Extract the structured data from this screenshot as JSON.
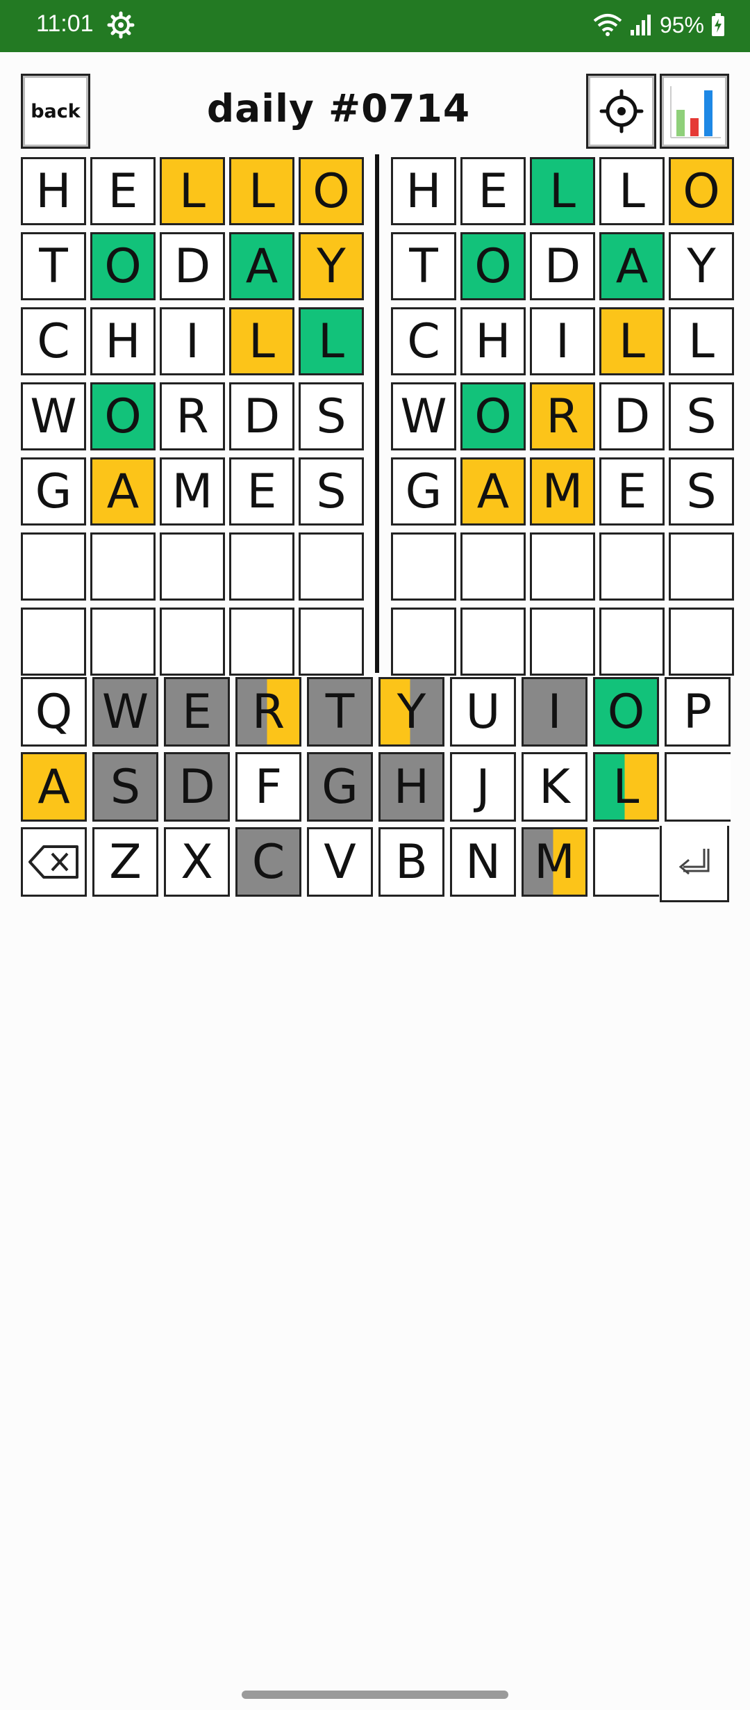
{
  "status_bar": {
    "time": "11:01",
    "battery_percent": "95%",
    "icons": [
      "settings-gear-icon",
      "wifi-icon",
      "signal-icon",
      "battery-charging-icon"
    ],
    "background": "#237a23"
  },
  "header": {
    "back_label": "back",
    "title": "daily #0714"
  },
  "colors": {
    "correct": "#12c27a",
    "present": "#fcc419",
    "absent": "#888888"
  },
  "boards": [
    {
      "rows": [
        [
          {
            "l": "H",
            "s": ""
          },
          {
            "l": "E",
            "s": ""
          },
          {
            "l": "L",
            "s": "y"
          },
          {
            "l": "L",
            "s": "y"
          },
          {
            "l": "O",
            "s": "y"
          }
        ],
        [
          {
            "l": "T",
            "s": ""
          },
          {
            "l": "O",
            "s": "g"
          },
          {
            "l": "D",
            "s": ""
          },
          {
            "l": "A",
            "s": "g"
          },
          {
            "l": "Y",
            "s": "y"
          }
        ],
        [
          {
            "l": "C",
            "s": ""
          },
          {
            "l": "H",
            "s": ""
          },
          {
            "l": "I",
            "s": ""
          },
          {
            "l": "L",
            "s": "y"
          },
          {
            "l": "L",
            "s": "g"
          }
        ],
        [
          {
            "l": "W",
            "s": ""
          },
          {
            "l": "O",
            "s": "g"
          },
          {
            "l": "R",
            "s": ""
          },
          {
            "l": "D",
            "s": ""
          },
          {
            "l": "S",
            "s": ""
          }
        ],
        [
          {
            "l": "G",
            "s": ""
          },
          {
            "l": "A",
            "s": "y"
          },
          {
            "l": "M",
            "s": ""
          },
          {
            "l": "E",
            "s": ""
          },
          {
            "l": "S",
            "s": ""
          }
        ],
        [
          {
            "l": "",
            "s": ""
          },
          {
            "l": "",
            "s": ""
          },
          {
            "l": "",
            "s": ""
          },
          {
            "l": "",
            "s": ""
          },
          {
            "l": "",
            "s": ""
          }
        ],
        [
          {
            "l": "",
            "s": ""
          },
          {
            "l": "",
            "s": ""
          },
          {
            "l": "",
            "s": ""
          },
          {
            "l": "",
            "s": ""
          },
          {
            "l": "",
            "s": ""
          }
        ]
      ]
    },
    {
      "rows": [
        [
          {
            "l": "H",
            "s": ""
          },
          {
            "l": "E",
            "s": ""
          },
          {
            "l": "L",
            "s": "g"
          },
          {
            "l": "L",
            "s": ""
          },
          {
            "l": "O",
            "s": "y"
          }
        ],
        [
          {
            "l": "T",
            "s": ""
          },
          {
            "l": "O",
            "s": "g"
          },
          {
            "l": "D",
            "s": ""
          },
          {
            "l": "A",
            "s": "g"
          },
          {
            "l": "Y",
            "s": ""
          }
        ],
        [
          {
            "l": "C",
            "s": ""
          },
          {
            "l": "H",
            "s": ""
          },
          {
            "l": "I",
            "s": ""
          },
          {
            "l": "L",
            "s": "y"
          },
          {
            "l": "L",
            "s": ""
          }
        ],
        [
          {
            "l": "W",
            "s": ""
          },
          {
            "l": "O",
            "s": "g"
          },
          {
            "l": "R",
            "s": "y"
          },
          {
            "l": "D",
            "s": ""
          },
          {
            "l": "S",
            "s": ""
          }
        ],
        [
          {
            "l": "G",
            "s": ""
          },
          {
            "l": "A",
            "s": "y"
          },
          {
            "l": "M",
            "s": "y"
          },
          {
            "l": "E",
            "s": ""
          },
          {
            "l": "S",
            "s": ""
          }
        ],
        [
          {
            "l": "",
            "s": ""
          },
          {
            "l": "",
            "s": ""
          },
          {
            "l": "",
            "s": ""
          },
          {
            "l": "",
            "s": ""
          },
          {
            "l": "",
            "s": ""
          }
        ],
        [
          {
            "l": "",
            "s": ""
          },
          {
            "l": "",
            "s": ""
          },
          {
            "l": "",
            "s": ""
          },
          {
            "l": "",
            "s": ""
          },
          {
            "l": "",
            "s": ""
          }
        ]
      ]
    }
  ],
  "keyboard": {
    "rows": [
      [
        {
          "k": "Q",
          "c": ""
        },
        {
          "k": "W",
          "c": "gray"
        },
        {
          "k": "E",
          "c": "gray"
        },
        {
          "k": "R",
          "c": "split-gy"
        },
        {
          "k": "T",
          "c": "gray"
        },
        {
          "k": "Y",
          "c": "split-yg"
        },
        {
          "k": "U",
          "c": ""
        },
        {
          "k": "I",
          "c": "gray"
        },
        {
          "k": "O",
          "c": "grn"
        },
        {
          "k": "P",
          "c": ""
        }
      ],
      [
        {
          "k": "A",
          "c": "yel"
        },
        {
          "k": "S",
          "c": "gray"
        },
        {
          "k": "D",
          "c": "gray"
        },
        {
          "k": "F",
          "c": ""
        },
        {
          "k": "G",
          "c": "gray"
        },
        {
          "k": "H",
          "c": "gray"
        },
        {
          "k": "J",
          "c": ""
        },
        {
          "k": "K",
          "c": ""
        },
        {
          "k": "L",
          "c": "split-gr-y"
        },
        {
          "k": "",
          "c": "blank"
        }
      ],
      [
        {
          "k": "backspace",
          "c": ""
        },
        {
          "k": "Z",
          "c": ""
        },
        {
          "k": "X",
          "c": ""
        },
        {
          "k": "C",
          "c": "gray"
        },
        {
          "k": "V",
          "c": ""
        },
        {
          "k": "B",
          "c": ""
        },
        {
          "k": "N",
          "c": ""
        },
        {
          "k": "M",
          "c": "split-gy"
        },
        {
          "k": "",
          "c": "blank"
        }
      ]
    ],
    "enter_icon": "enter-return-icon",
    "backspace_icon": "backspace-icon"
  }
}
